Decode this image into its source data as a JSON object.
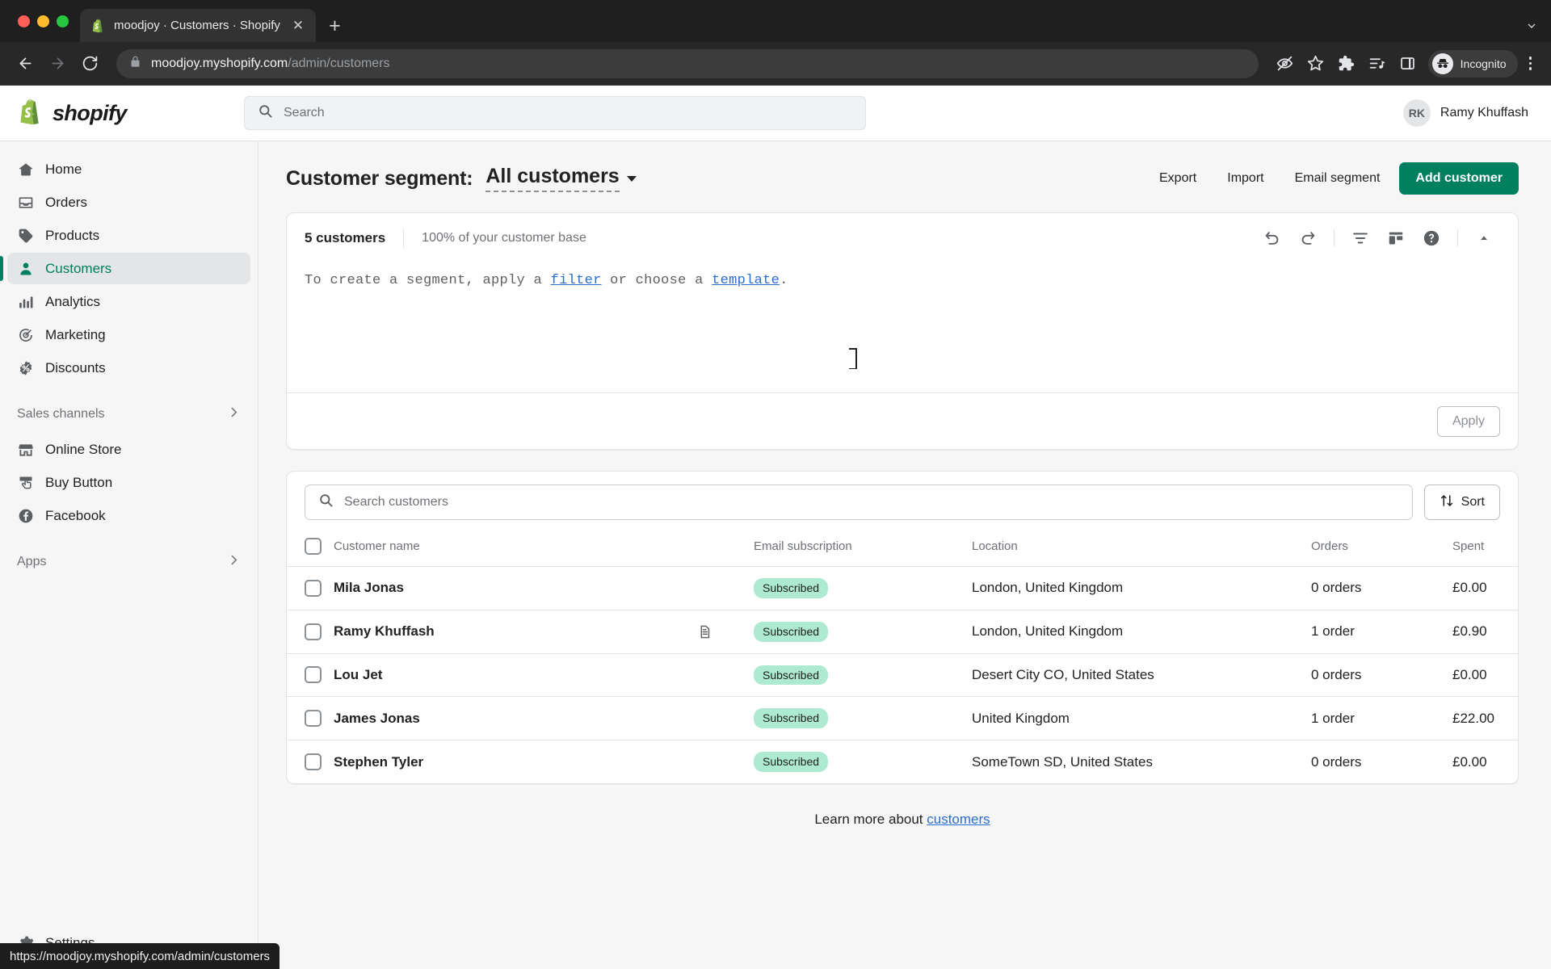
{
  "browser": {
    "tab": {
      "title": "moodjoy · Customers · Shopify",
      "favicon": "shopify-favicon",
      "close_label": "✕"
    },
    "newtab_label": "+",
    "tabstrip_right_icon": "chevron-down-icon",
    "url_strong": "moodjoy.myshopify.com",
    "url_dim": "/admin/customers",
    "toolbar_icons": [
      "back-arrow-icon",
      "forward-arrow-icon",
      "reload-icon",
      "lock-icon"
    ],
    "right_icons": [
      "third-party-cookie-blocked-icon",
      "bookmark-star-icon",
      "extensions-puzzle-icon",
      "reading-list-icon",
      "side-panel-icon"
    ],
    "incognito_label": "Incognito",
    "menu_icon": "kebab-menu-icon"
  },
  "topbar": {
    "logo_word": "shopify",
    "search_placeholder": "Search",
    "search_value": "",
    "avatar_initials": "RK",
    "account_name": "Ramy Khuffash"
  },
  "sidebar": {
    "items": [
      {
        "label": "Home",
        "icon": "home-icon",
        "active": false
      },
      {
        "label": "Orders",
        "icon": "orders-inbox-icon",
        "active": false
      },
      {
        "label": "Products",
        "icon": "product-tag-icon",
        "active": false
      },
      {
        "label": "Customers",
        "icon": "customers-person-icon",
        "active": true
      },
      {
        "label": "Analytics",
        "icon": "analytics-bars-icon",
        "active": false
      },
      {
        "label": "Marketing",
        "icon": "marketing-target-icon",
        "active": false
      },
      {
        "label": "Discounts",
        "icon": "discount-percent-icon",
        "active": false
      }
    ],
    "sales_channels_label": "Sales channels",
    "channels": [
      {
        "label": "Online Store",
        "icon": "storefront-icon"
      },
      {
        "label": "Buy Button",
        "icon": "buy-button-icon"
      },
      {
        "label": "Facebook",
        "icon": "facebook-icon"
      }
    ],
    "apps_label": "Apps",
    "settings_label": "Settings",
    "settings_icon": "gear-icon"
  },
  "page": {
    "title": "Customer segment:",
    "segment_name": "All customers",
    "actions": {
      "export": "Export",
      "import": "Import",
      "email_segment": "Email segment",
      "add_customer": "Add customer"
    }
  },
  "segment_card": {
    "count": "5 customers",
    "subtitle": "100% of your customer base",
    "tools": [
      {
        "name": "undo-icon"
      },
      {
        "name": "redo-icon"
      },
      {
        "name": "filter-funnel-icon"
      },
      {
        "name": "columns-layout-icon"
      },
      {
        "name": "help-question-icon"
      },
      {
        "name": "collapse-chevron-up-icon"
      }
    ],
    "editor": {
      "prefix": "To create a segment, apply a ",
      "link_filter": "filter",
      "middle": " or choose a ",
      "link_template": "template",
      "suffix": "."
    },
    "apply_label": "Apply"
  },
  "list": {
    "search_placeholder": "Search customers",
    "search_value": "",
    "sort_label": "Sort",
    "sort_icon": "sort-arrows-icon",
    "columns": [
      "Customer name",
      "Email subscription",
      "Location",
      "Orders",
      "Spent"
    ],
    "rows": [
      {
        "name": "Mila Jonas",
        "note": false,
        "subscription": "Subscribed",
        "location": "London, United Kingdom",
        "orders": "0 orders",
        "spent": "£0.00"
      },
      {
        "name": "Ramy Khuffash",
        "note": true,
        "subscription": "Subscribed",
        "location": "London, United Kingdom",
        "orders": "1 order",
        "spent": "£0.90"
      },
      {
        "name": "Lou Jet",
        "note": false,
        "subscription": "Subscribed",
        "location": "Desert City CO, United States",
        "orders": "0 orders",
        "spent": "£0.00"
      },
      {
        "name": "James Jonas",
        "note": false,
        "subscription": "Subscribed",
        "location": "United Kingdom",
        "orders": "1 order",
        "spent": "£22.00"
      },
      {
        "name": "Stephen Tyler",
        "note": false,
        "subscription": "Subscribed",
        "location": "SomeTown SD, United States",
        "orders": "0 orders",
        "spent": "£0.00"
      }
    ]
  },
  "footer": {
    "learn_prefix": "Learn more about ",
    "learn_link": "customers"
  },
  "statusbar": {
    "url": "https://moodjoy.myshopify.com/admin/customers"
  },
  "colors": {
    "brand_green": "#008060",
    "accent_link": "#2c6ecb",
    "badge_bg": "#aee9d1",
    "sidebar_bg": "#f6f6f7",
    "active_text": "#007f5f"
  }
}
